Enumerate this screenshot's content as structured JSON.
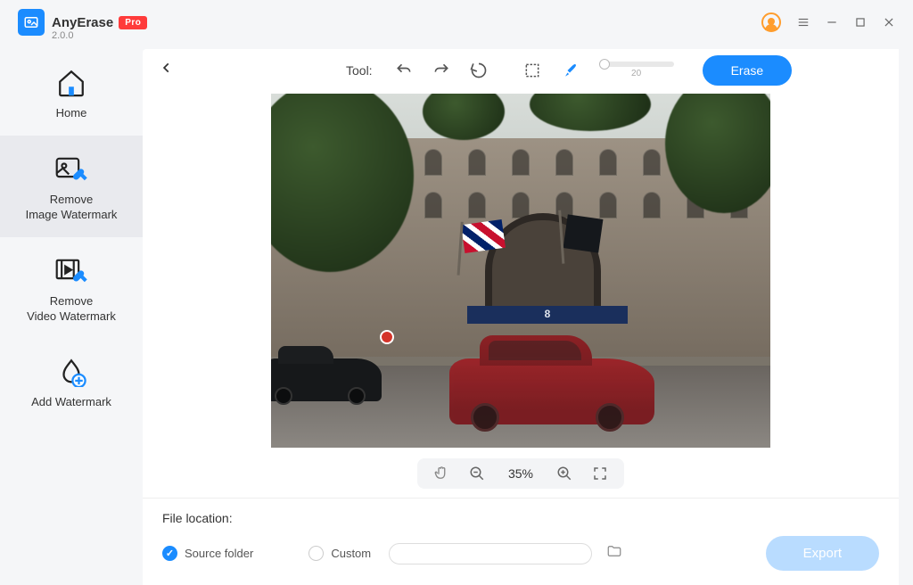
{
  "app": {
    "name": "AnyErase",
    "badge": "Pro",
    "version": "2.0.0"
  },
  "nav": {
    "home": "Home",
    "removeImage": "Remove\nImage Watermark",
    "removeVideo": "Remove\nVideo Watermark",
    "addWatermark": "Add Watermark"
  },
  "toolbar": {
    "toolLabel": "Tool:",
    "brushSize": "20",
    "eraseLabel": "Erase"
  },
  "zoom": {
    "value": "35%"
  },
  "footer": {
    "locationLabel": "File location:",
    "sourceFolder": "Source folder",
    "custom": "Custom",
    "export": "Export"
  },
  "canvas": {
    "awningNumber": "8"
  }
}
